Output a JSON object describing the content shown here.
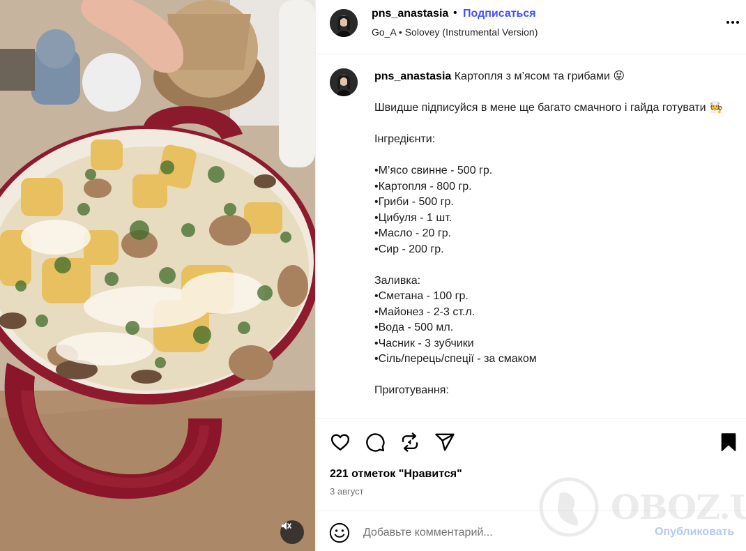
{
  "post": {
    "username": "pns_anastasia",
    "follow_label": "Подписаться",
    "audio_artist": "Go_A",
    "audio_track": "Solovey (Instrumental Version)"
  },
  "caption": {
    "username": "pns_anastasia",
    "title": "Картопля з м’ясом та грибами 😝",
    "lines": [
      "Швидше підписуйся в мене ще багато смачного і гайда готувати 🧑‍🍳",
      "",
      "Інгредієнти:",
      "",
      "•М’ясо свинне - 500 гр.",
      "•Картопля - 800 гр.",
      "•Гриби - 500 гр.",
      "•Цибуля - 1 шт.",
      "•Масло - 20 гр.",
      "•Сир - 200 гр.",
      "",
      "Заливка:",
      "•Сметана - 100 гр.",
      "•Майонез - 2-3 ст.л.",
      "•Вода - 500 мл.",
      "•Часник - 3 зубчики",
      "•Сіль/перець/спеції - за смаком",
      "",
      "Приготування:"
    ]
  },
  "actions": {
    "likes_text": "221 отметок \"Нравится\"",
    "date": "3 август"
  },
  "comment": {
    "placeholder": "Добавьте комментарий...",
    "publish_label": "Опубликовать"
  },
  "watermark": {
    "text": "OBOZ.UA"
  },
  "icons": {
    "like": "heart-icon",
    "comment": "comment-bubble-icon",
    "repost": "repost-icon",
    "share": "paper-plane-icon",
    "save": "bookmark-icon",
    "more": "more-dots-icon",
    "emoji": "smiley-icon",
    "mute": "speaker-muted-icon"
  },
  "colors": {
    "follow": "#4150f7",
    "publish_disabled": "#b2c8f5",
    "secondary_text": "#737373",
    "divider": "#efefef",
    "pan": "#8e1a2e"
  }
}
